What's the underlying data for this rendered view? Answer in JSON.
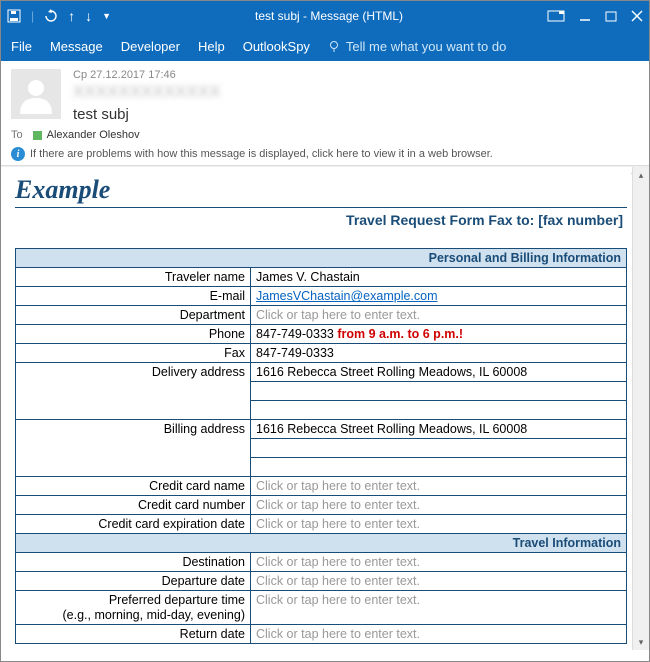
{
  "titlebar": {
    "title": "test subj - Message (HTML)"
  },
  "menu": {
    "file": "File",
    "message": "Message",
    "developer": "Developer",
    "help": "Help",
    "spy": "OutlookSpy",
    "tellme": "Tell me what you want to do"
  },
  "msg": {
    "date": "Cp 27.12.2017 17:46",
    "from": "XXXXXXXXXXXXX",
    "subject": "test subj",
    "to_label": "To",
    "to_value": "Alexander Oleshov"
  },
  "infobar": "If there are problems with how this message is displayed, click here to view it in a web browser.",
  "doc": {
    "heading": "Example",
    "fax_header": "Travel Request Form Fax to: [fax number]",
    "section1": "Personal and Billing Information",
    "section2": "Travel Information",
    "placeholder": "Click or tap here to enter text.",
    "labels": {
      "traveler": "Traveler name",
      "email": "E-mail",
      "dept": "Department",
      "phone": "Phone",
      "fax": "Fax",
      "deliv": "Delivery address",
      "bill": "Billing address",
      "ccname": "Credit card name",
      "ccnum": "Credit card number",
      "ccexp": "Credit card expiration date",
      "dest": "Destination",
      "ddate": "Departure date",
      "ptime": "Preferred departure time",
      "ptime2": "(e.g., morning, mid-day, evening)",
      "rdate": "Return date"
    },
    "values": {
      "traveler": "James V. Chastain",
      "email": "JamesVChastain@example.com",
      "phone": "847-749-0333 ",
      "phone_note": "from 9 a.m. to 6 p.m.!",
      "fax": "847-749-0333",
      "addr": "1616 Rebecca Street Rolling Meadows, IL 60008"
    }
  }
}
